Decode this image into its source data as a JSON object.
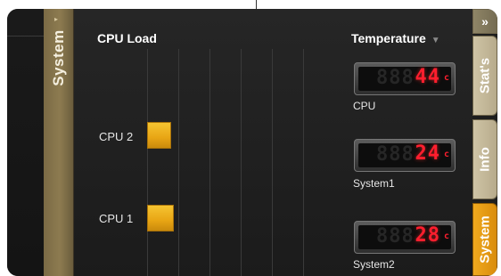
{
  "left_tab": {
    "label": "System",
    "arrow": "▸"
  },
  "cpu_load": {
    "title": "CPU Load",
    "bars": [
      {
        "label": "CPU 2",
        "value": 0.07
      },
      {
        "label": "CPU 1",
        "value": 0.08
      }
    ]
  },
  "temperature": {
    "title": "Temperature",
    "caret": "▼",
    "sensors": [
      {
        "label": "CPU",
        "value": "44",
        "unit": "c",
        "ghost": "888"
      },
      {
        "label": "System1",
        "value": "24",
        "unit": "c",
        "ghost": "888"
      },
      {
        "label": "System2",
        "value": "28",
        "unit": "c",
        "ghost": "888"
      }
    ]
  },
  "right_tabs": {
    "collapse": "»",
    "stats": "Stat's",
    "info": "Info",
    "system": "System"
  },
  "colors": {
    "bar": "#f0b020",
    "lcd_digit": "#ff1e2e",
    "active_tab": "#f0a91e",
    "inactive_tab": "#c4b898"
  }
}
